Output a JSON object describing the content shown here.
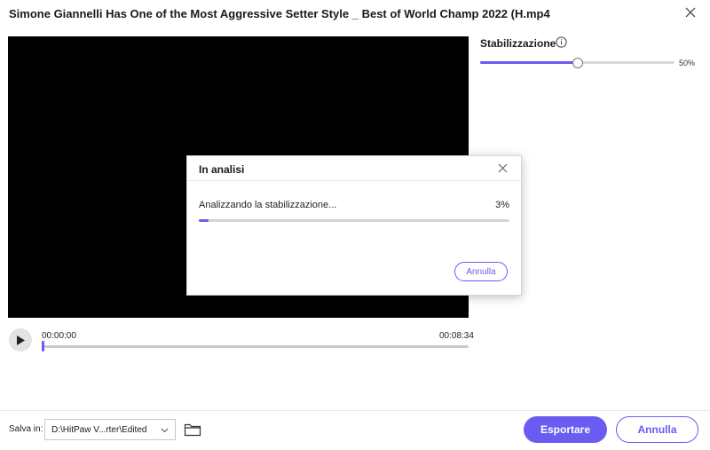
{
  "window": {
    "title": "Simone Giannelli Has One of the Most Aggressive Setter Style _ Best of World Champ 2022 (H.mp4"
  },
  "player": {
    "time_start": "00:00:00",
    "time_end": "00:08:34",
    "progress": 0
  },
  "stabilization": {
    "label": "Stabilizzazione",
    "value": 50,
    "value_text": "50%"
  },
  "modal": {
    "title": "In analisi",
    "status": "Analizzando la stabilizzazione...",
    "percent": 3,
    "percent_text": "3%",
    "cancel_label": "Annulla"
  },
  "footer": {
    "save_label": "Salva in:",
    "path": "D:\\HitPaw V...rter\\Edited",
    "export_label": "Esportare",
    "cancel_label": "Annulla"
  },
  "colors": {
    "accent": "#6a5cf0"
  }
}
